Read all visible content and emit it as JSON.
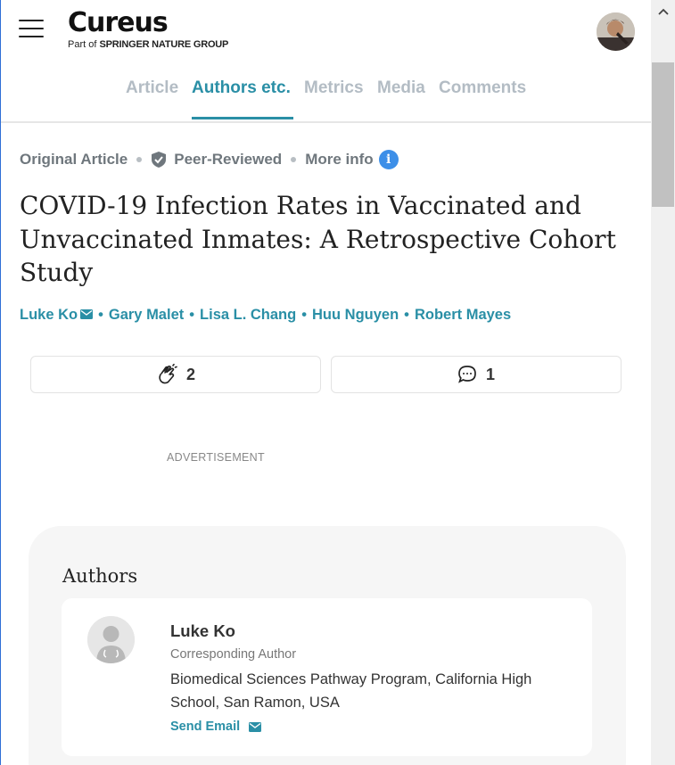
{
  "header": {
    "logo_text": "Cureus",
    "logo_sub_prefix": "Part of",
    "logo_sub_brand": "SPRINGER NATURE GROUP"
  },
  "tabs": [
    {
      "label": "Article",
      "active": false
    },
    {
      "label": "Authors etc.",
      "active": true
    },
    {
      "label": "Metrics",
      "active": false
    },
    {
      "label": "Media",
      "active": false
    },
    {
      "label": "Comments",
      "active": false
    }
  ],
  "meta": {
    "article_type": "Original Article",
    "review_status": "Peer-Reviewed",
    "more_info": "More info"
  },
  "article": {
    "title": "COVID-19 Infection Rates in Vaccinated and Unvaccinated Inmates: A Retrospective Cohort Study",
    "authors": [
      "Luke Ko",
      "Gary Malet",
      "Lisa L. Chang",
      "Huu Nguyen",
      "Robert Mayes"
    ],
    "separator": "•"
  },
  "stats": {
    "scholarly_impact_count": "2",
    "comments_count": "1"
  },
  "advertisement_label": "ADVERTISEMENT",
  "authors_section": {
    "heading": "Authors",
    "items": [
      {
        "name": "Luke Ko",
        "role": "Corresponding Author",
        "affiliation": "Biomedical Sciences Pathway Program, California High School, San Ramon, USA",
        "send_email_label": "Send Email"
      }
    ]
  },
  "colors": {
    "accent": "#2a8fa6",
    "tab_inactive": "#b3bcc4",
    "info_icon": "#3d8fe8",
    "card_bg": "#f6f6f6"
  },
  "icons": [
    "menu-icon",
    "user-avatar",
    "shield-check-icon",
    "info-icon",
    "mail-icon",
    "clap-icon",
    "comment-icon",
    "scroll-up-arrow-icon"
  ]
}
